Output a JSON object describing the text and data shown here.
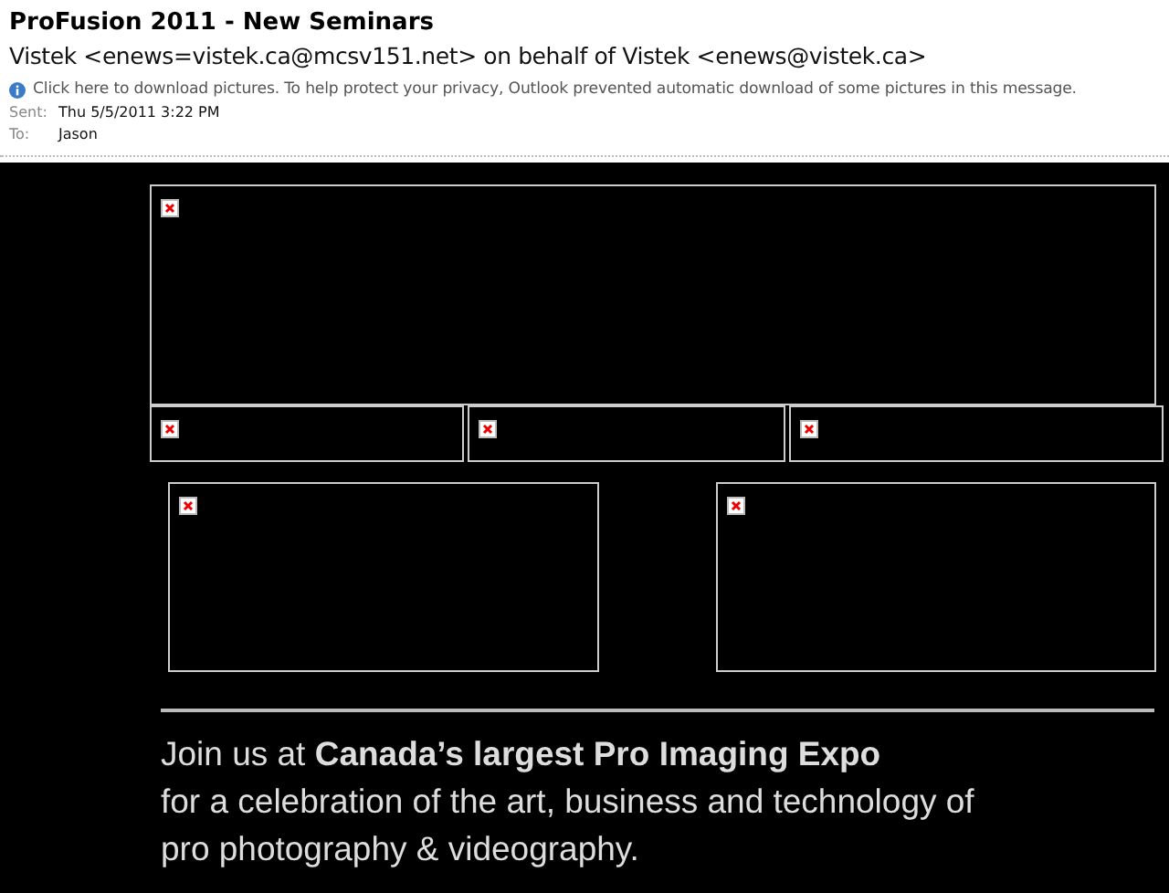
{
  "subject": "ProFusion 2011 - New Seminars",
  "sender": "Vistek <enews=vistek.ca@mcsv151.net> on behalf of Vistek <enews@vistek.ca>",
  "info_bar": "Click here to download pictures. To help protect your privacy, Outlook prevented automatic download of some pictures in this message.",
  "fields": [
    {
      "label": "Sent:",
      "value": "Thu 5/5/2011 3:22 PM"
    },
    {
      "label": "To:",
      "value": "Jason"
    }
  ],
  "body": {
    "banner": {
      "kind": "broken-image"
    },
    "strip": [
      {
        "kind": "broken-image"
      },
      {
        "kind": "broken-image"
      },
      {
        "kind": "broken-image"
      }
    ],
    "pair": [
      {
        "kind": "broken-image"
      },
      {
        "kind": "broken-image"
      }
    ],
    "message": "Join us at **Canada’s largest Pro Imaging Expo**\nfor a celebration of the art, business and technology of\npro photography & videography."
  }
}
